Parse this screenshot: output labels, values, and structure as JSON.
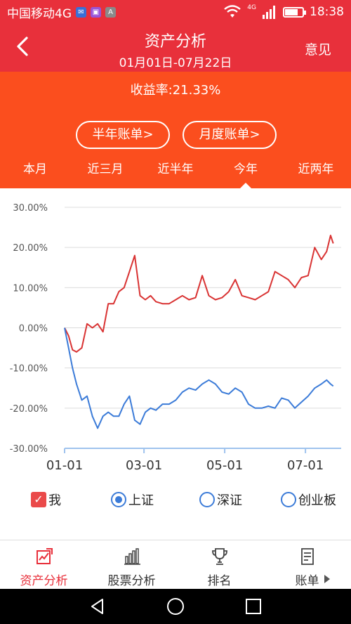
{
  "status_bar": {
    "carrier": "中国移动4G",
    "network": "4G",
    "time": "18:38",
    "battery_level": 0.75
  },
  "header": {
    "title": "资产分析",
    "date_range": "01月01日-07月22日",
    "feedback_label": "意见"
  },
  "summary": {
    "yield_text": "收益率:21.33%",
    "half_year_bill": "半年账单>",
    "monthly_bill": "月度账单>"
  },
  "period_tabs": [
    {
      "label": "本月",
      "active": false
    },
    {
      "label": "近三月",
      "active": false
    },
    {
      "label": "近半年",
      "active": false
    },
    {
      "label": "今年",
      "active": true
    },
    {
      "label": "近两年",
      "active": false
    }
  ],
  "legend": {
    "me": "我",
    "shanghai": "上证",
    "shenzhen": "深证",
    "chinext": "创业板"
  },
  "bottom_nav": [
    {
      "label": "资产分析",
      "icon": "asset-analysis-icon",
      "active": true
    },
    {
      "label": "股票分析",
      "icon": "bar-chart-icon",
      "active": false
    },
    {
      "label": "排名",
      "icon": "trophy-icon",
      "active": false
    },
    {
      "label": "账单",
      "icon": "bill-icon",
      "active": false
    }
  ],
  "colors": {
    "brand_red": "#e8303b",
    "orange": "#fb4e1e",
    "series_me": "#d93333",
    "series_shanghai": "#3b7bd8"
  },
  "chart_data": {
    "type": "line",
    "ylim": [
      -30,
      30
    ],
    "yticks": [
      30,
      20,
      10,
      0,
      -10,
      -20,
      -30
    ],
    "ytick_labels": [
      "30.00%",
      "20.00%",
      "10.00%",
      "0.00%",
      "-10.00%",
      "-20.00%",
      "-30.00%"
    ],
    "xticks": [
      "01-01",
      "03-01",
      "05-01",
      "07-01"
    ],
    "grid": true,
    "series": [
      {
        "name": "我",
        "color": "#d93333",
        "x": [
          "01-01",
          "01-04",
          "01-07",
          "01-10",
          "01-14",
          "01-18",
          "01-22",
          "01-26",
          "01-30",
          "02-03",
          "02-07",
          "02-11",
          "02-15",
          "02-19",
          "02-23",
          "02-27",
          "03-02",
          "03-06",
          "03-10",
          "03-15",
          "03-20",
          "03-25",
          "03-30",
          "04-04",
          "04-09",
          "04-14",
          "04-19",
          "04-24",
          "04-29",
          "05-04",
          "05-09",
          "05-14",
          "05-19",
          "05-24",
          "05-29",
          "06-03",
          "06-08",
          "06-13",
          "06-18",
          "06-23",
          "06-28",
          "07-03",
          "07-08",
          "07-13",
          "07-17",
          "07-20",
          "07-22"
        ],
        "values": [
          0,
          -2,
          -5.5,
          -6,
          -5,
          1,
          0,
          1,
          -1,
          6,
          6,
          9,
          10,
          14,
          18,
          8,
          7,
          8,
          6.5,
          6,
          6,
          7,
          8,
          7,
          7.5,
          13,
          8,
          7,
          7.5,
          9,
          12,
          8,
          7.5,
          7,
          8,
          9,
          14,
          13,
          12,
          10,
          12.5,
          13,
          20,
          17,
          19,
          23,
          21
        ]
      },
      {
        "name": "上证",
        "color": "#3b7bd8",
        "x": [
          "01-01",
          "01-04",
          "01-07",
          "01-10",
          "01-14",
          "01-18",
          "01-22",
          "01-26",
          "01-30",
          "02-03",
          "02-07",
          "02-11",
          "02-15",
          "02-19",
          "02-23",
          "02-27",
          "03-02",
          "03-06",
          "03-10",
          "03-15",
          "03-20",
          "03-25",
          "03-30",
          "04-04",
          "04-09",
          "04-14",
          "04-19",
          "04-24",
          "04-29",
          "05-04",
          "05-09",
          "05-14",
          "05-19",
          "05-24",
          "05-29",
          "06-03",
          "06-08",
          "06-13",
          "06-18",
          "06-23",
          "06-28",
          "07-03",
          "07-08",
          "07-13",
          "07-17",
          "07-20",
          "07-22"
        ],
        "values": [
          0,
          -5,
          -10,
          -14,
          -18,
          -17,
          -22,
          -25,
          -22,
          -21,
          -22,
          -22,
          -19,
          -17,
          -23,
          -24,
          -21,
          -20,
          -20.5,
          -19,
          -19,
          -18,
          -16,
          -15,
          -15.5,
          -14,
          -13,
          -14,
          -16,
          -16.5,
          -15,
          -16,
          -19,
          -20,
          -20,
          -19.5,
          -20,
          -17.5,
          -18,
          -20,
          -18.5,
          -17,
          -15,
          -14,
          -13,
          -14,
          -14.5
        ]
      }
    ]
  }
}
